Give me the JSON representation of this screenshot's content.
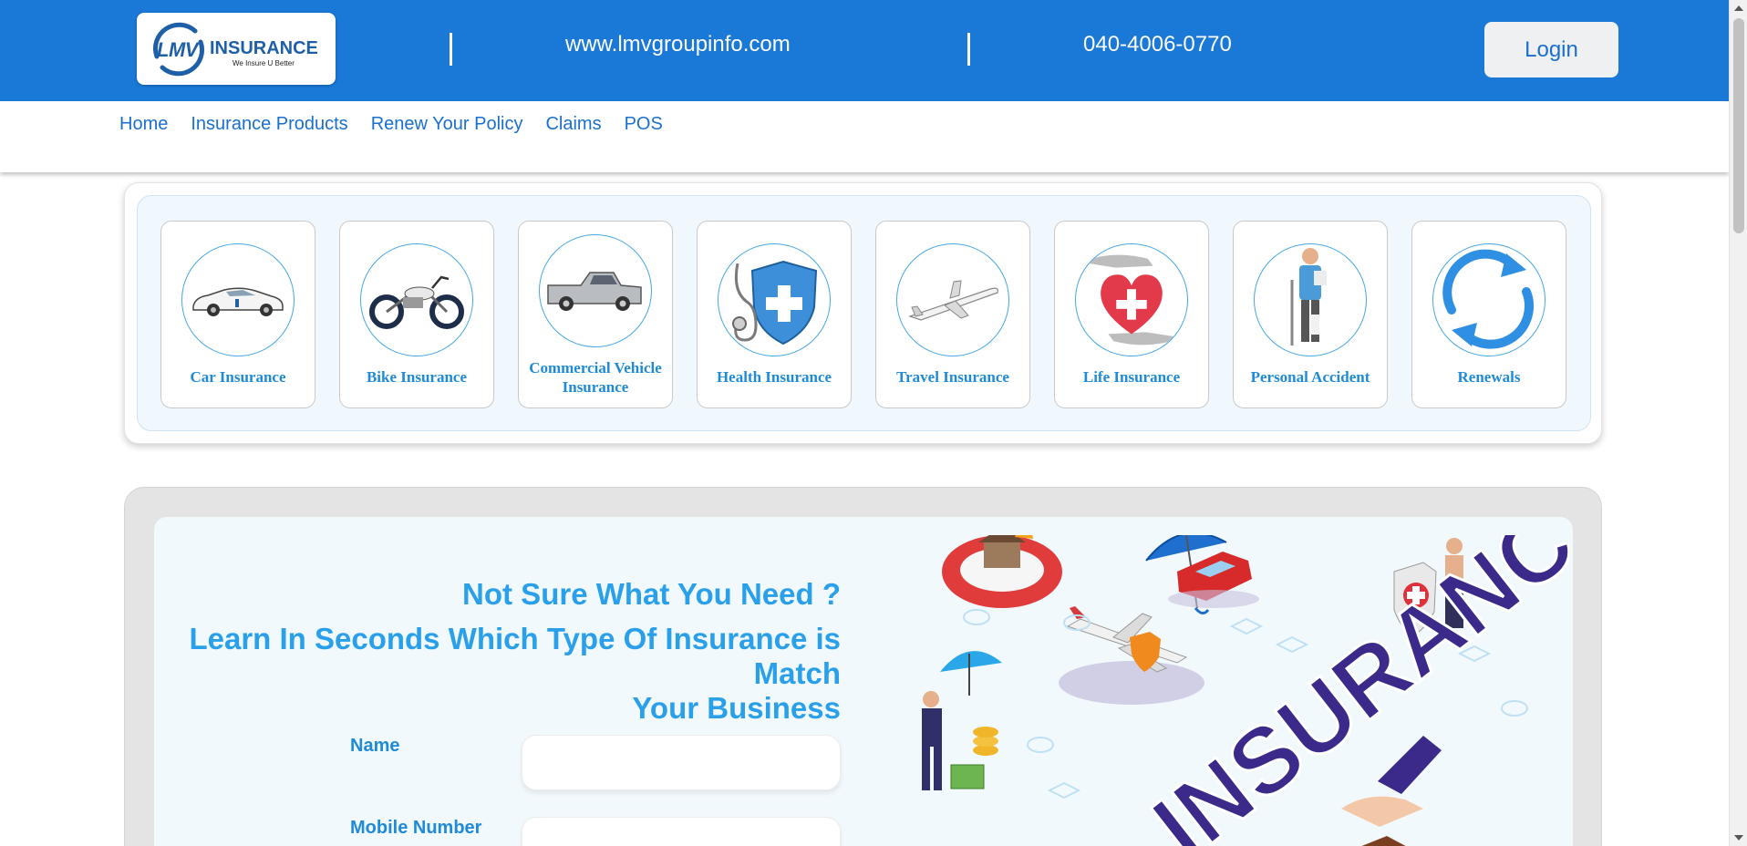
{
  "header": {
    "logo_brand": "LMV",
    "logo_name": "INSURANCE",
    "logo_tagline": "We Insure U Better",
    "website": "www.lmvgroupinfo.com",
    "phone": "040-4006-0770",
    "login_label": "Login",
    "bar_color": "#1a78d6"
  },
  "nav": {
    "items": [
      {
        "label": "Home"
      },
      {
        "label": "Insurance Products"
      },
      {
        "label": "Renew Your Policy"
      },
      {
        "label": "Claims"
      },
      {
        "label": "POS"
      }
    ]
  },
  "products": {
    "items": [
      {
        "label": "Car Insurance",
        "icon": "car-icon"
      },
      {
        "label": "Bike Insurance",
        "icon": "motorcycle-icon"
      },
      {
        "label": "Commercial Vehicle Insurance",
        "icon": "pickup-truck-icon"
      },
      {
        "label": "Health Insurance",
        "icon": "stethoscope-shield-icon"
      },
      {
        "label": "Travel Insurance",
        "icon": "airplane-icon"
      },
      {
        "label": "Life Insurance",
        "icon": "heart-cross-icon"
      },
      {
        "label": "Personal Accident",
        "icon": "injured-person-icon"
      },
      {
        "label": "Renewals",
        "icon": "renew-arrows-icon"
      }
    ]
  },
  "hero": {
    "title": "Not Sure What You Need ?",
    "subtitle_line1": "Learn In Seconds Which Type Of Insurance is Match",
    "subtitle_line2": "Your Business",
    "form": {
      "name_label": "Name",
      "name_value": "",
      "mobile_label": "Mobile Number",
      "mobile_value": ""
    },
    "illustration_text": "INSURANCE",
    "accent_color": "#2aa0ea"
  }
}
